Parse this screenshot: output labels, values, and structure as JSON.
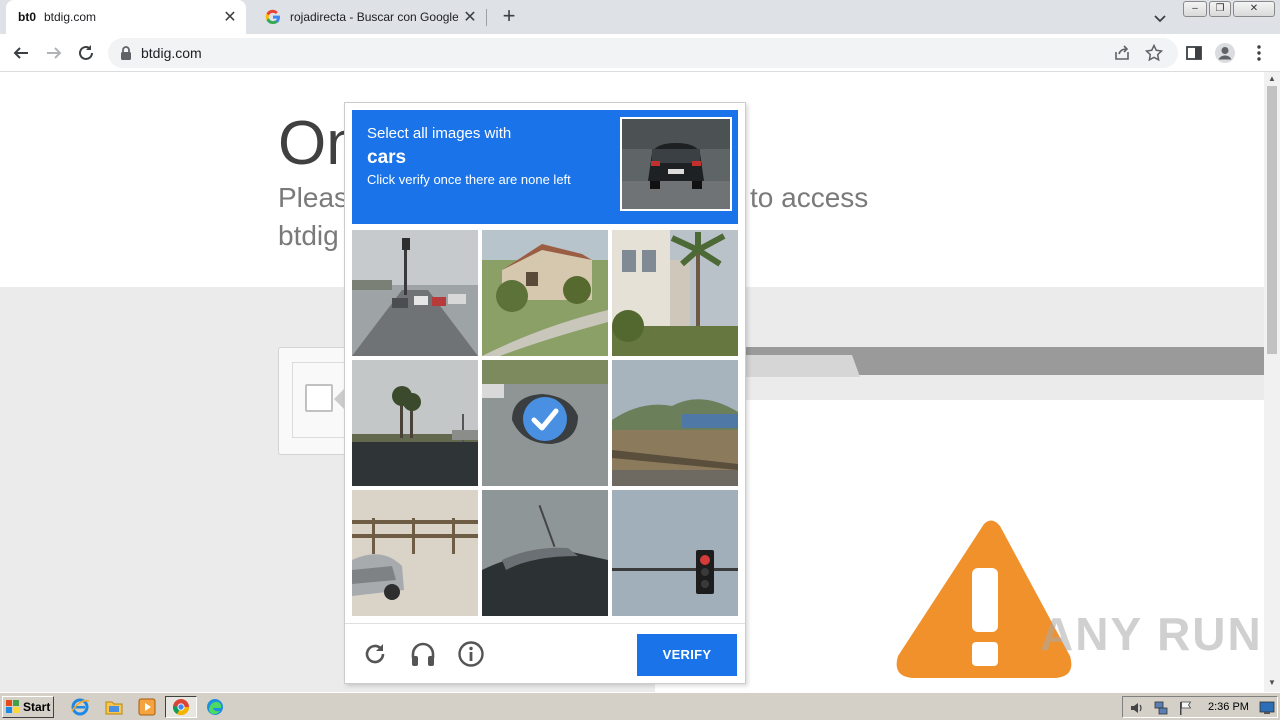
{
  "browser": {
    "tabs": [
      {
        "favicon": "bt0",
        "title": "btdig.com",
        "active": true
      },
      {
        "favicon": "google-g-icon",
        "title": "rojadirecta - Buscar con Google",
        "active": false
      }
    ],
    "new_tab": "+",
    "close": "✕",
    "url": "btdig.com"
  },
  "page": {
    "heading": "On",
    "subtitle_line1_start": "Pleas",
    "subtitle_line1_end": "to access",
    "subtitle_line2": "btdig"
  },
  "captcha": {
    "instruction": "Select all images with",
    "target": "cars",
    "hint": "Click verify once there are none left",
    "verify_label": "VERIFY",
    "tiles": [
      {
        "index": 0,
        "scene": "road-with-cars",
        "selected": false
      },
      {
        "index": 1,
        "scene": "house-garden",
        "selected": false
      },
      {
        "index": 2,
        "scene": "building-palm",
        "selected": false
      },
      {
        "index": 3,
        "scene": "palm-trees-road",
        "selected": false
      },
      {
        "index": 4,
        "scene": "car-top-view",
        "selected": true
      },
      {
        "index": 5,
        "scene": "coast-hills",
        "selected": false
      },
      {
        "index": 6,
        "scene": "car-by-fence",
        "selected": false
      },
      {
        "index": 7,
        "scene": "car-roof",
        "selected": false
      },
      {
        "index": 8,
        "scene": "traffic-light",
        "selected": false
      }
    ],
    "footer_icons": [
      "reload-icon",
      "audio-icon",
      "info-icon"
    ],
    "accent_color": "#1a73e8"
  },
  "watermark": "ANY RUN",
  "taskbar": {
    "start_label": "Start",
    "clock": "2:36 PM"
  }
}
